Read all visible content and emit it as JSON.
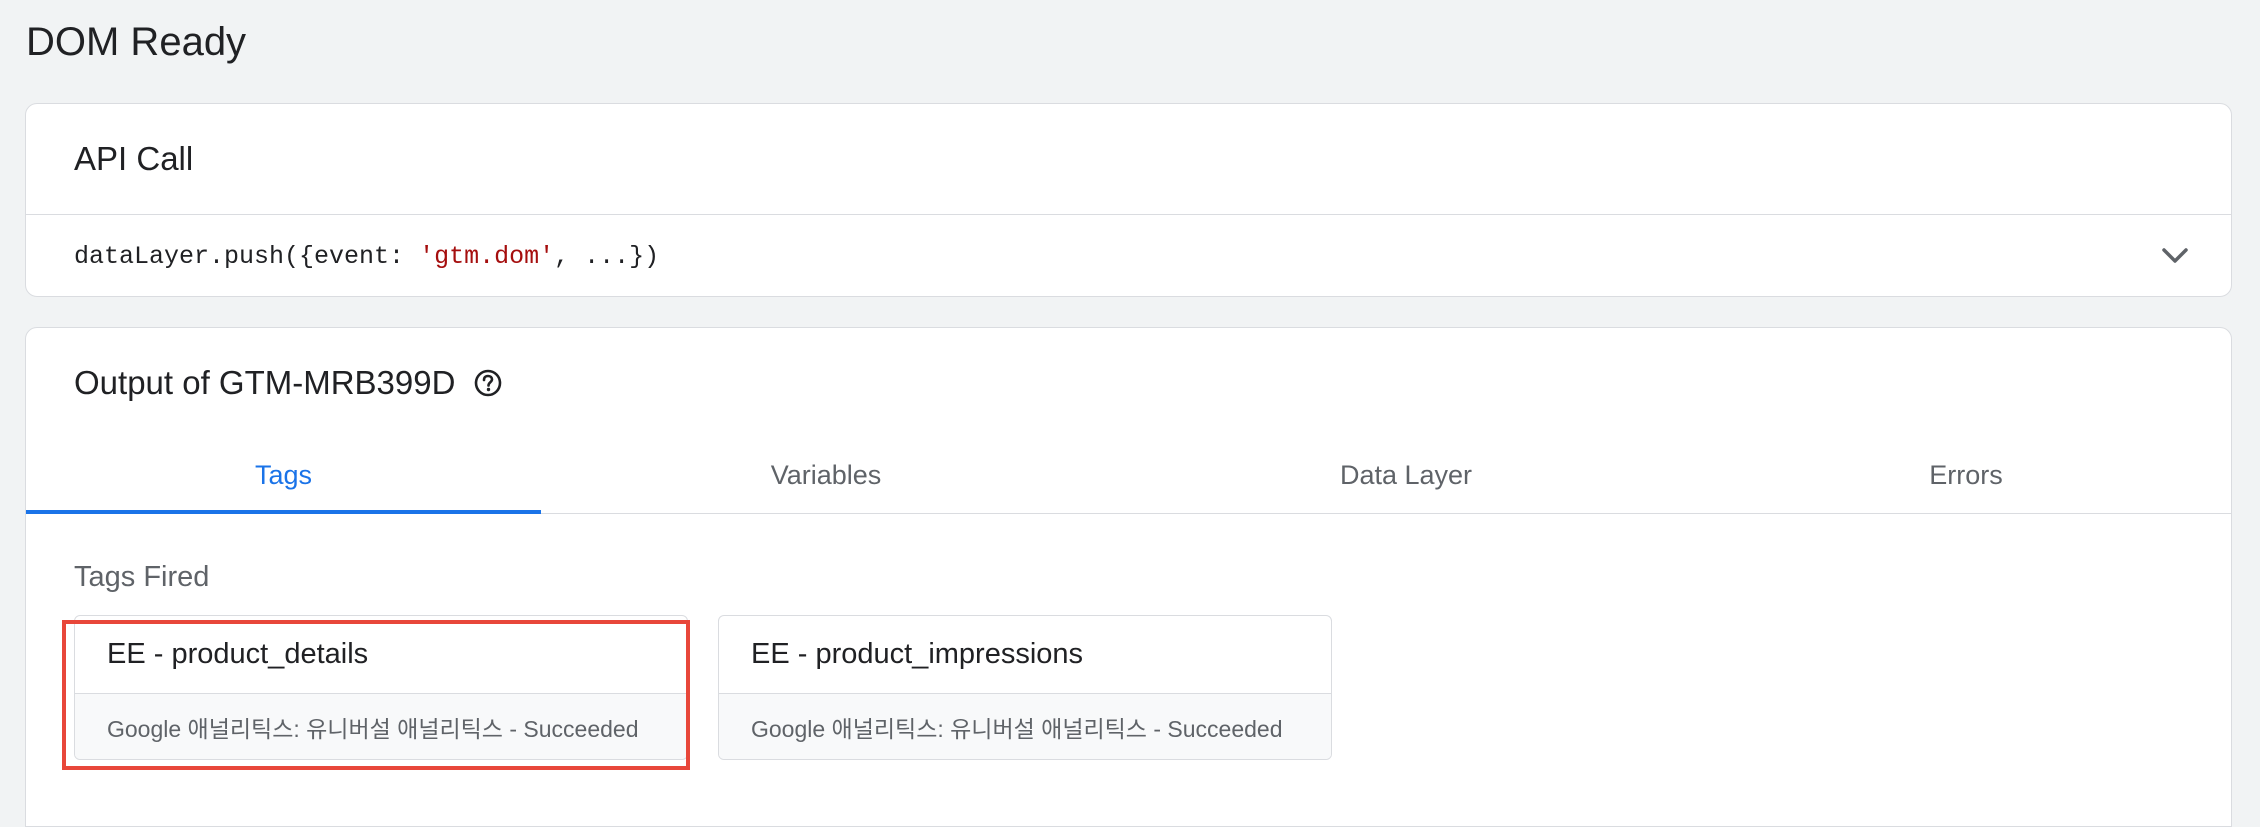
{
  "page": {
    "title": "DOM Ready"
  },
  "api_call": {
    "header": "API Call",
    "code_prefix": "dataLayer.push({event: ",
    "code_string": "'gtm.dom'",
    "code_suffix": ", ...})"
  },
  "output": {
    "header": "Output of GTM-MRB399D",
    "tabs": [
      {
        "label": "Tags",
        "active": true
      },
      {
        "label": "Variables",
        "active": false
      },
      {
        "label": "Data Layer",
        "active": false
      },
      {
        "label": "Errors",
        "active": false
      }
    ],
    "section_label": "Tags Fired",
    "tags": [
      {
        "name": "EE - product_details",
        "status": "Google 애널리틱스: 유니버설 애널리틱스 - Succeeded"
      },
      {
        "name": "EE - product_impressions",
        "status": "Google 애널리틱스: 유니버설 애널리틱스 - Succeeded"
      }
    ]
  },
  "icons": {
    "expand": "chevron-down-icon",
    "help": "help-circle-icon"
  },
  "colors": {
    "accent": "#1a73e8",
    "code_string": "#a50e0e",
    "highlight": "#e8473a"
  }
}
